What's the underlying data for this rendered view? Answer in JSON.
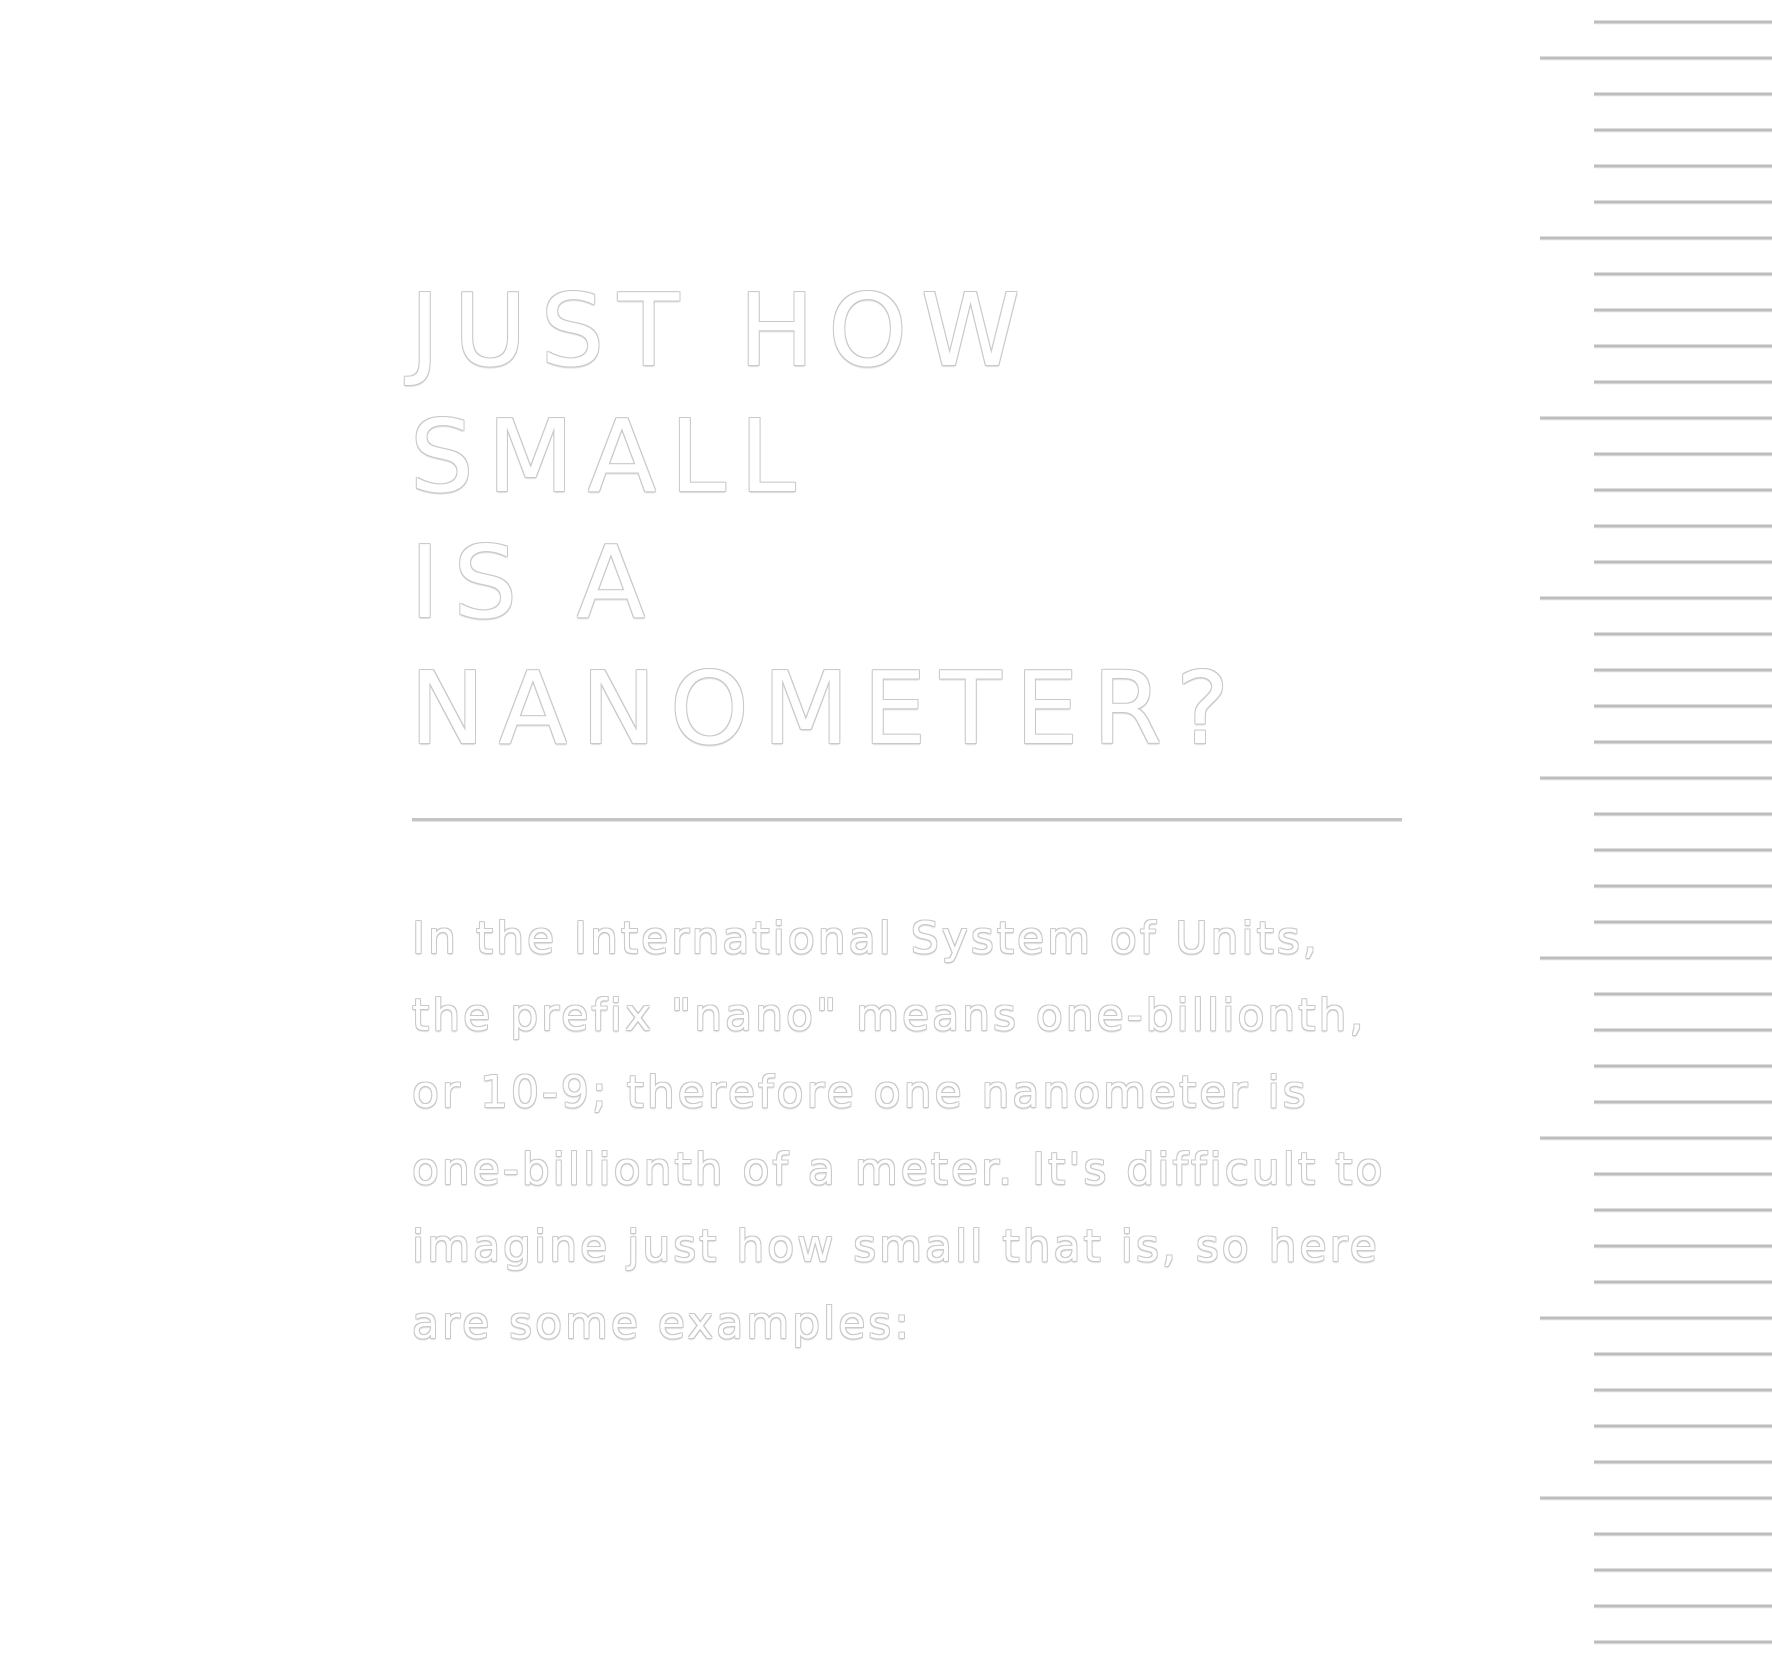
{
  "heading": {
    "lines": [
      "JUST HOW",
      "SMALL",
      "IS A",
      "NANOMETER?"
    ]
  },
  "body": {
    "lines": [
      "In the International System of Units,",
      "the prefix \"nano\" means one-billionth,",
      "or 10-9; therefore one nanometer is",
      "one-billionth of a meter. It's difficult to",
      "imagine just how small that is, so here",
      "are some examples:"
    ]
  },
  "colors": {
    "background": "#ffffff",
    "outline": "#c9c9c9",
    "rule_line": "#bdbdbd"
  }
}
